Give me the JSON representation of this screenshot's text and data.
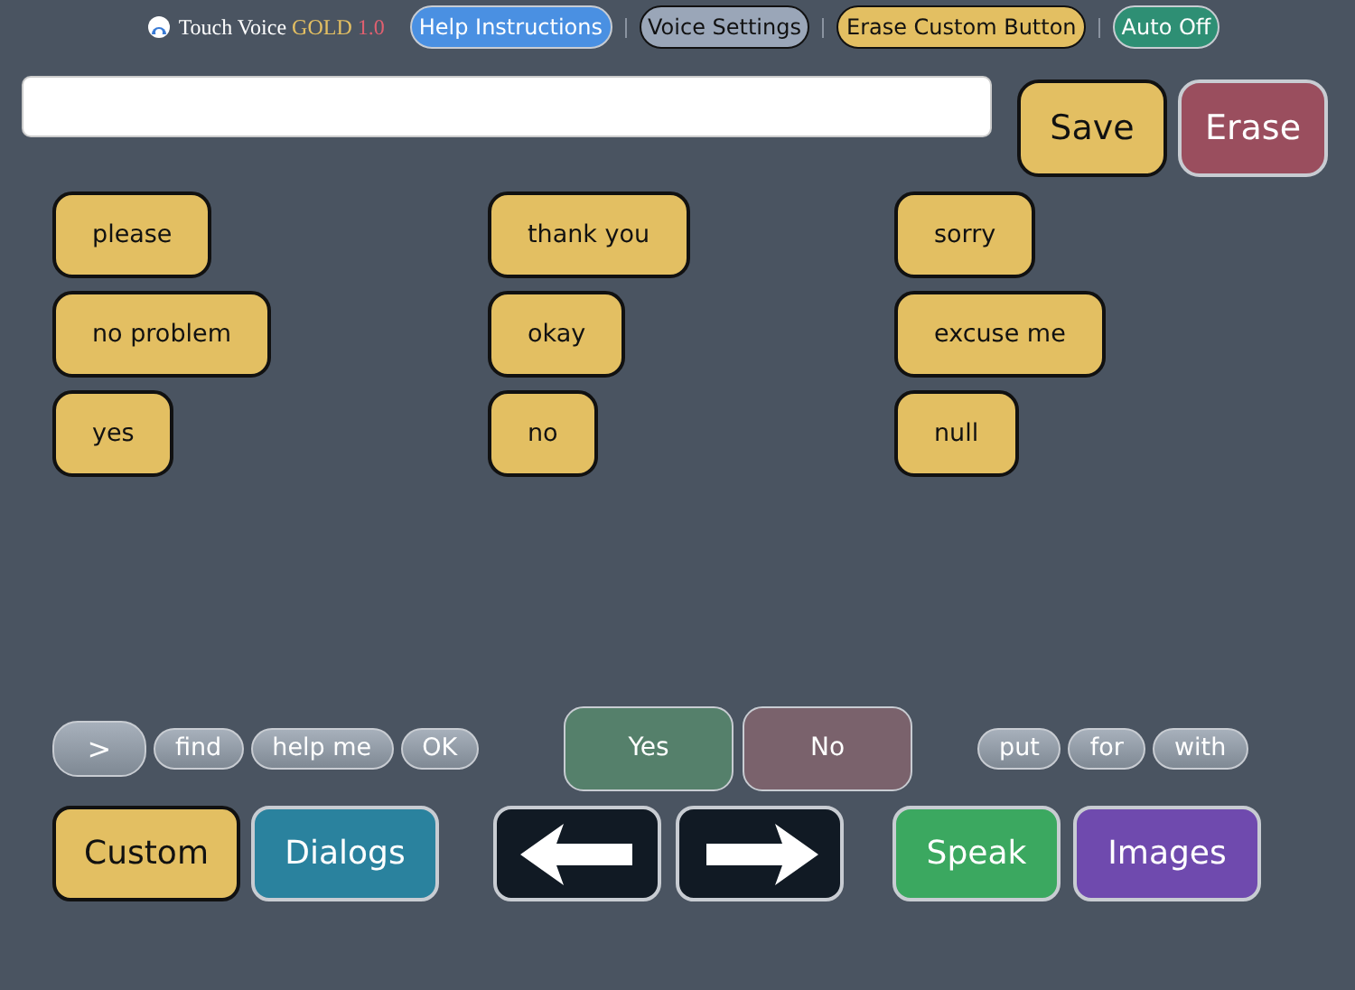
{
  "header": {
    "brand": "Touch Voice",
    "edition": "GOLD",
    "version": "1.0",
    "buttons": [
      {
        "label": "Help Instructions",
        "color": "#4a90e2"
      },
      {
        "label": "Voice Settings",
        "color": "#9aa6b8"
      },
      {
        "label": "Erase Custom Button",
        "color": "#e3bf62"
      },
      {
        "label": "Auto Off",
        "color": "#2e8f74"
      }
    ]
  },
  "actions": [
    {
      "label": "Save",
      "color": "#e3bf62"
    },
    {
      "label": "Erase",
      "color": "#9a4e5e"
    }
  ],
  "phrases": [
    [
      "please",
      "thank you",
      "sorry"
    ],
    [
      "no problem",
      "okay",
      "excuse me"
    ],
    [
      "yes",
      "no",
      "null"
    ]
  ],
  "quick_left": [
    ">",
    "find",
    "help me",
    "OK"
  ],
  "answers": [
    {
      "label": "Yes",
      "color": "#55806b"
    },
    {
      "label": "No",
      "color": "#7a626c"
    }
  ],
  "quick_right": [
    "put",
    "for",
    "with"
  ],
  "nav": [
    {
      "kind": "text",
      "label": "Custom",
      "color": "#e3bf62"
    },
    {
      "kind": "text",
      "label": "Dialogs",
      "color": "#2a829e"
    },
    {
      "kind": "arrow-left",
      "color": "#111a24"
    },
    {
      "kind": "arrow-right",
      "color": "#111a24"
    },
    {
      "kind": "text",
      "label": "Speak",
      "color": "#3ba860"
    },
    {
      "kind": "text",
      "label": "Images",
      "color": "#6f4aae"
    }
  ]
}
